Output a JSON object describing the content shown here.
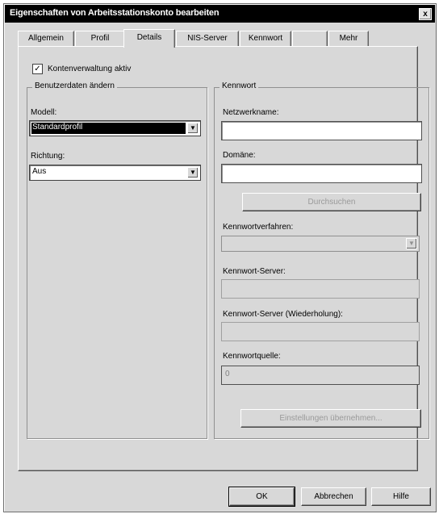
{
  "window": {
    "title": "Eigenschaften von Arbeitsstationskonto bearbeiten",
    "close_label": "x"
  },
  "tabs": [
    {
      "label": "Allgemein"
    },
    {
      "label": "Profil"
    },
    {
      "label": "Details"
    },
    {
      "label": "NIS-Server"
    },
    {
      "label": "Kennwort"
    },
    {
      "label": ""
    },
    {
      "label": "Mehr"
    }
  ],
  "checkbox": {
    "label": "Kontenverwaltung aktiv",
    "checked_glyph": "✓"
  },
  "left_group": {
    "title": "Benutzerdaten ändern",
    "field1_label": "Modell:",
    "field1_value": "Standardprofil",
    "field2_label": "Richtung:",
    "field2_value": "Aus"
  },
  "right_group": {
    "title": "Kennwort",
    "field1_label": "Netzwerkname:",
    "field2_label": "Domäne:",
    "search_button": "Durchsuchen",
    "field3_label": "Kennwortverfahren:",
    "field4_label": "Kennwort-Server:",
    "field5_label": "Kennwort-Server (Wiederholung):",
    "field6_label": "Kennwortquelle:",
    "field6_value": "0",
    "bottom_button": "Einstellungen übernehmen..."
  },
  "footer": {
    "ok": "OK",
    "cancel": "Abbrechen",
    "help": "Hilfe"
  }
}
